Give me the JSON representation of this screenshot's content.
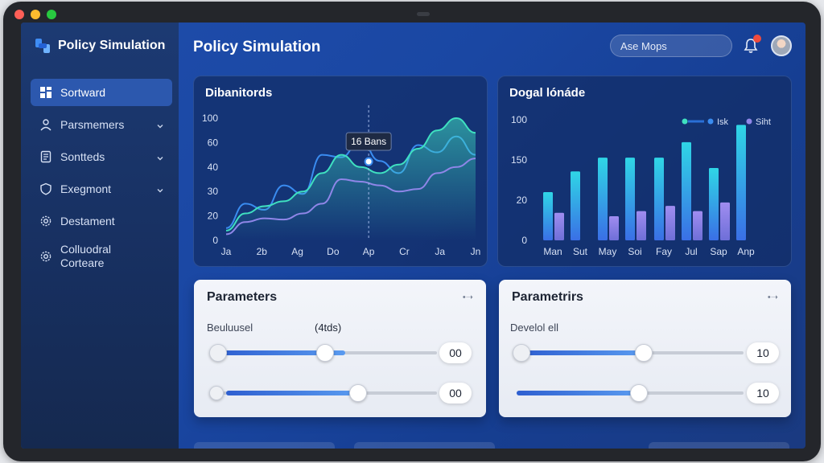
{
  "app": {
    "title": "Policy Simulation",
    "page_title": "Policy Simulation"
  },
  "header": {
    "search_placeholder": "Ase Mops"
  },
  "sidebar": {
    "items": [
      {
        "label": "Sortward",
        "icon": "dashboard-icon",
        "active": true,
        "chevron": false
      },
      {
        "label": "Parsmemers",
        "icon": "users-icon",
        "active": false,
        "chevron": true
      },
      {
        "label": "Sontteds",
        "icon": "document-icon",
        "active": false,
        "chevron": true
      },
      {
        "label": "Exegmont",
        "icon": "shield-icon",
        "active": false,
        "chevron": true
      },
      {
        "label": "Destament",
        "icon": "gear-icon",
        "active": false,
        "chevron": false
      },
      {
        "label": "Colluodral Corteare",
        "icon": "gear-icon",
        "active": false,
        "chevron": false
      }
    ]
  },
  "colors": {
    "accent": "#2c58ae",
    "line1": "#3a8cf0",
    "line2": "#3fe0c0",
    "line3": "#8f86e8",
    "bar1": "#2cc8e0",
    "bar2": "#8f86e8"
  },
  "chart_data": [
    {
      "type": "area",
      "title": "Dibanitords",
      "categories": [
        "Ja",
        "2b",
        "Ag",
        "Do",
        "Ap",
        "Cr",
        "Ja",
        "Jn"
      ],
      "y_ticks": [
        "100",
        "60",
        "40",
        "30",
        "20",
        "0"
      ],
      "tooltip": {
        "label": "16 Bans",
        "category": "Ap"
      },
      "series": [
        {
          "values": [
            10,
            30,
            25,
            45,
            38,
            70,
            68,
            82,
            65,
            55,
            78,
            72,
            85,
            70
          ]
        },
        {
          "values": [
            8,
            22,
            28,
            32,
            40,
            55,
            70,
            60,
            55,
            62,
            75,
            90,
            100,
            88
          ]
        },
        {
          "values": [
            5,
            15,
            18,
            17,
            22,
            30,
            50,
            48,
            45,
            40,
            42,
            55,
            60,
            67
          ]
        }
      ]
    },
    {
      "type": "bar",
      "title": "Dogal lónáde",
      "categories": [
        "Man",
        "Sut",
        "May",
        "Soi",
        "Fay",
        "Jul",
        "Sap",
        "Anp"
      ],
      "y_ticks": [
        "100",
        "150",
        "20",
        "0"
      ],
      "legend": [
        "Isk",
        "Siht"
      ],
      "series": [
        {
          "name": "Isk",
          "values": [
            28,
            40,
            48,
            48,
            48,
            57,
            42,
            67
          ]
        },
        {
          "name": "Siht",
          "values": [
            16,
            0,
            14,
            17,
            20,
            17,
            22,
            0
          ]
        }
      ]
    }
  ],
  "params_left": {
    "title": "Parameters",
    "label": "Beuluusel",
    "note": "(4tds)",
    "sliders": [
      {
        "value": 0.58,
        "display": "00"
      },
      {
        "value": 0.64,
        "display": "00"
      }
    ]
  },
  "params_right": {
    "title": "Parametrirs",
    "label": "Develol ell",
    "sliders": [
      {
        "value": 0.55,
        "display": "10"
      },
      {
        "value": 0.54,
        "display": "10"
      }
    ]
  }
}
